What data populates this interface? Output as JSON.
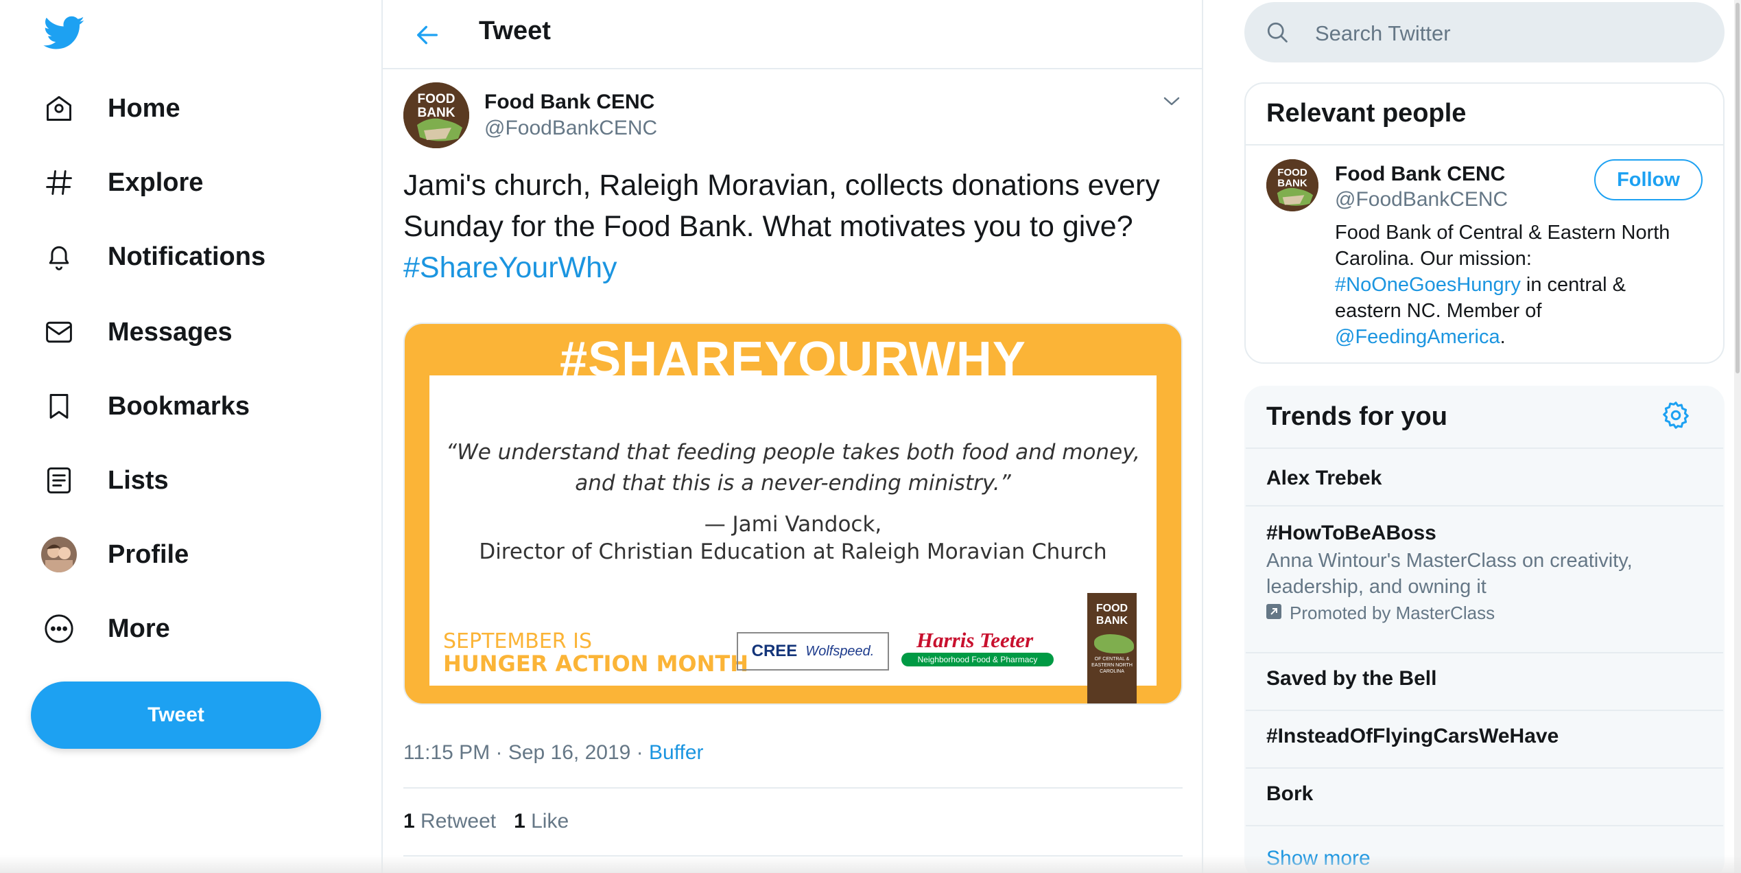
{
  "nav": {
    "items": [
      {
        "label": "Home",
        "icon": "home-icon"
      },
      {
        "label": "Explore",
        "icon": "hashtag-icon"
      },
      {
        "label": "Notifications",
        "icon": "bell-icon"
      },
      {
        "label": "Messages",
        "icon": "envelope-icon"
      },
      {
        "label": "Bookmarks",
        "icon": "bookmark-icon"
      },
      {
        "label": "Lists",
        "icon": "list-icon"
      },
      {
        "label": "Profile",
        "icon": "avatar"
      },
      {
        "label": "More",
        "icon": "more-icon"
      }
    ],
    "tweet_button": "Tweet"
  },
  "header": {
    "title": "Tweet"
  },
  "tweet": {
    "author_name": "Food Bank CENC",
    "author_handle": "@FoodBankCENC",
    "avatar_text": "FOOD BANK",
    "text_plain": "Jami's church, Raleigh Moravian, collects donations every Sunday for the Food Bank.  What motivates you to give?  ",
    "hashtag": "#ShareYourWhy",
    "image": {
      "headline": "#SHAREYOURWHY",
      "quote_line1": "“We understand that feeding people takes both food and money,",
      "quote_line2": "and that this is a never-ending ministry.”",
      "attribution_line1": "— Jami Vandock,",
      "attribution_line2": "Director of Christian Education at Raleigh Moravian Church",
      "sept_line1": "SEPTEMBER IS",
      "sept_line2": "HUNGER ACTION MONTH",
      "sponsor1_a": "CREE",
      "sponsor1_b": "Wolfspeed.",
      "sponsor2": "Harris Teeter",
      "sponsor2_tag": "Neighborhood Food & Pharmacy",
      "fb_logo": "FOOD BANK",
      "fb_logo_sub": "OF CENTRAL & EASTERN NORTH CAROLINA"
    },
    "time": "11:15 PM · Sep 16, 2019 · ",
    "source": "Buffer",
    "retweet_count": "1",
    "retweet_label": "Retweet",
    "like_count": "1",
    "like_label": "Like"
  },
  "search": {
    "placeholder": "Search Twitter"
  },
  "relevant": {
    "title": "Relevant people",
    "name": "Food Bank CENC",
    "handle": "@FoodBankCENC",
    "follow": "Follow",
    "bio1": "Food Bank of Central & Eastern North Carolina. Our mission: ",
    "bio_tag": "#NoOneGoesHungry",
    "bio2": " in central & eastern NC. Member of ",
    "bio_mention": "@FeedingAmerica",
    "bio3": "."
  },
  "trends": {
    "title": "Trends for you",
    "items": [
      {
        "name": "Alex Trebek"
      },
      {
        "name": "#HowToBeABoss",
        "desc": "Anna Wintour's MasterClass on creativity, leadership, and owning it",
        "promo": "Promoted by MasterClass"
      },
      {
        "name": "Saved by the Bell"
      },
      {
        "name": "#InsteadOfFlyingCarsWeHave"
      },
      {
        "name": "Bork"
      }
    ],
    "show_more": "Show more"
  },
  "colors": {
    "accent": "#1da1f2",
    "link": "#1b95e0",
    "secondary_text": "#657786",
    "image_bg": "#fbb437"
  }
}
